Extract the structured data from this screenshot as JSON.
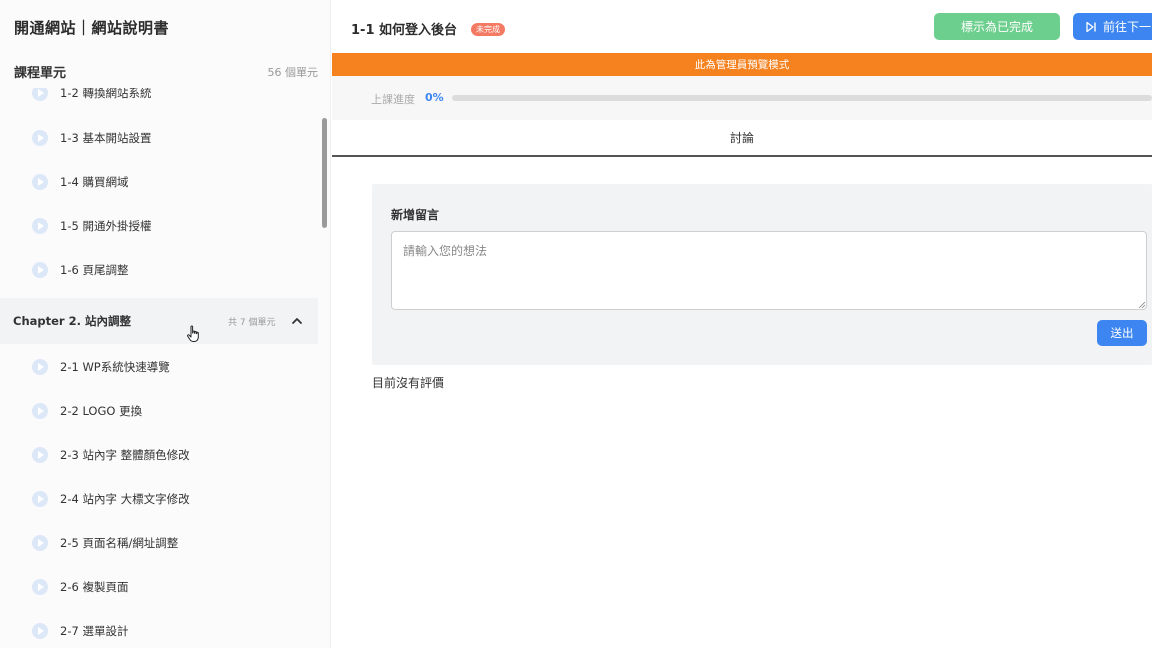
{
  "sidebar": {
    "site_title": "開通網站｜網站說明書",
    "units_title": "課程單元",
    "units_count": "56 個單元",
    "chapter1_lessons": [
      {
        "label": "1-2 轉換網站系統"
      },
      {
        "label": "1-3 基本開站設置"
      },
      {
        "label": "1-4 購買網域"
      },
      {
        "label": "1-5 開通外掛授權"
      },
      {
        "label": "1-6 頁尾調整"
      }
    ],
    "chapter2": {
      "title": "Chapter 2. 站內調整",
      "count": "共 7 個單元"
    },
    "chapter2_lessons": [
      {
        "label": "2-1 WP系統快速導覽"
      },
      {
        "label": "2-2 LOGO 更換"
      },
      {
        "label": "2-3 站內字 整體顏色修改"
      },
      {
        "label": "2-4 站內字 大標文字修改"
      },
      {
        "label": "2-5 頁面名稱/網址調整"
      },
      {
        "label": "2-6 複製頁面"
      },
      {
        "label": "2-7 選單設計"
      }
    ]
  },
  "header": {
    "lesson_title": "1-1 如何登入後台",
    "status_badge": "未完成",
    "mark_complete_label": "標示為已完成",
    "next_label": "前往下一"
  },
  "admin_banner": "此為管理員預覽模式",
  "progress": {
    "label": "上課進度",
    "value_text": "0%",
    "fraction": 0
  },
  "tabs": {
    "discussion": "討論"
  },
  "comment": {
    "title": "新增留言",
    "placeholder": "請輸入您的想法",
    "value": "",
    "submit_label": "送出"
  },
  "reviews": {
    "empty_text": "目前沒有評價"
  },
  "colors": {
    "primary": "#3d86f2",
    "success": "#6dcf8e",
    "banner": "#f5821f",
    "badge": "#f47a63"
  },
  "icons": [
    "play-icon",
    "chevron-up-icon",
    "skip-next-icon",
    "hand-pointer-icon",
    "resize-grip-icon"
  ]
}
